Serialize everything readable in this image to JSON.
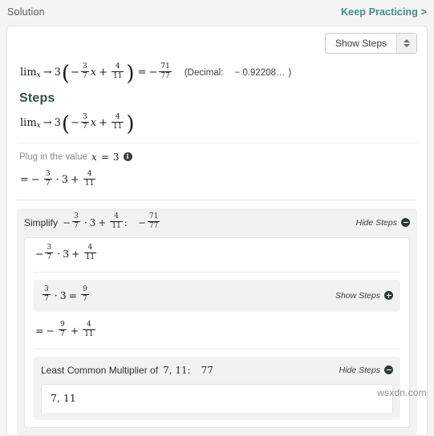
{
  "header": {
    "solution_label": "Solution",
    "keep_practicing_label": "Keep Practicing >",
    "link_color": "#3f8f84"
  },
  "toolbar": {
    "show_steps_label": "Show Steps",
    "stepper_up_icon": "caret-up-icon",
    "stepper_down_icon": "caret-down-icon"
  },
  "main_equation": {
    "lim_label": "lim",
    "lim_subscript": "x",
    "arrow": "→",
    "approach_value": "3",
    "open_paren": "(",
    "close_paren": ")",
    "minus": "−",
    "coef_num": "3",
    "coef_den": "7",
    "variable": "x",
    "plus": "+",
    "const_num": "4",
    "const_den": "11",
    "equals": "=",
    "result_sign": "−",
    "result_num": "71",
    "result_den": "77",
    "decimal_open": "(Decimal:",
    "decimal_value": "− 0.92208…",
    "decimal_close": ")"
  },
  "steps": {
    "heading": "Steps",
    "expression": {
      "lim_label": "lim",
      "lim_subscript": "x",
      "arrow": "→",
      "approach_value": "3",
      "minus": "−",
      "coef_num": "3",
      "coef_den": "7",
      "variable": "x",
      "plus": "+",
      "const_num": "4",
      "const_den": "11"
    },
    "plug_in": {
      "text": "Plug in the value",
      "variable": "x",
      "equals": "=",
      "value": "3",
      "info_icon": "info-icon"
    },
    "plug_result": {
      "equals": "=",
      "minus": "−",
      "num": "3",
      "den": "7",
      "dot": "·",
      "factor": "3",
      "plus": "+",
      "const_num": "4",
      "const_den": "11"
    }
  },
  "simplify_step": {
    "label": "Simplify",
    "minus": "−",
    "num": "3",
    "den": "7",
    "dot": "·",
    "factor": "3",
    "plus": "+",
    "const_num": "4",
    "const_den": "11",
    "colon": ":",
    "result_sign": "−",
    "result_num": "71",
    "result_den": "77",
    "toggle_label": "Hide Steps",
    "toggle_icon": "minus-circle-icon",
    "body_expression": {
      "minus": "−",
      "num": "3",
      "den": "7",
      "dot": "·",
      "factor": "3",
      "plus": "+",
      "const_num": "4",
      "const_den": "11"
    },
    "sub_step": {
      "num": "3",
      "den": "7",
      "dot": "·",
      "factor": "3",
      "equals": "=",
      "result_num": "9",
      "result_den": "7",
      "toggle_label": "Show Steps",
      "toggle_icon": "plus-circle-icon"
    },
    "intermediate_result": {
      "equals": "=",
      "minus": "−",
      "num": "9",
      "den": "7",
      "plus": "+",
      "const_num": "4",
      "const_den": "11"
    },
    "lcm_step": {
      "label": "Least Common Multiplier of",
      "operands": "7, 11",
      "colon": ":",
      "result": "77",
      "toggle_label": "Hide Steps",
      "toggle_icon": "minus-circle-icon",
      "body_value": "7, 11"
    }
  },
  "watermark": {
    "text": "wsxdn.com"
  }
}
